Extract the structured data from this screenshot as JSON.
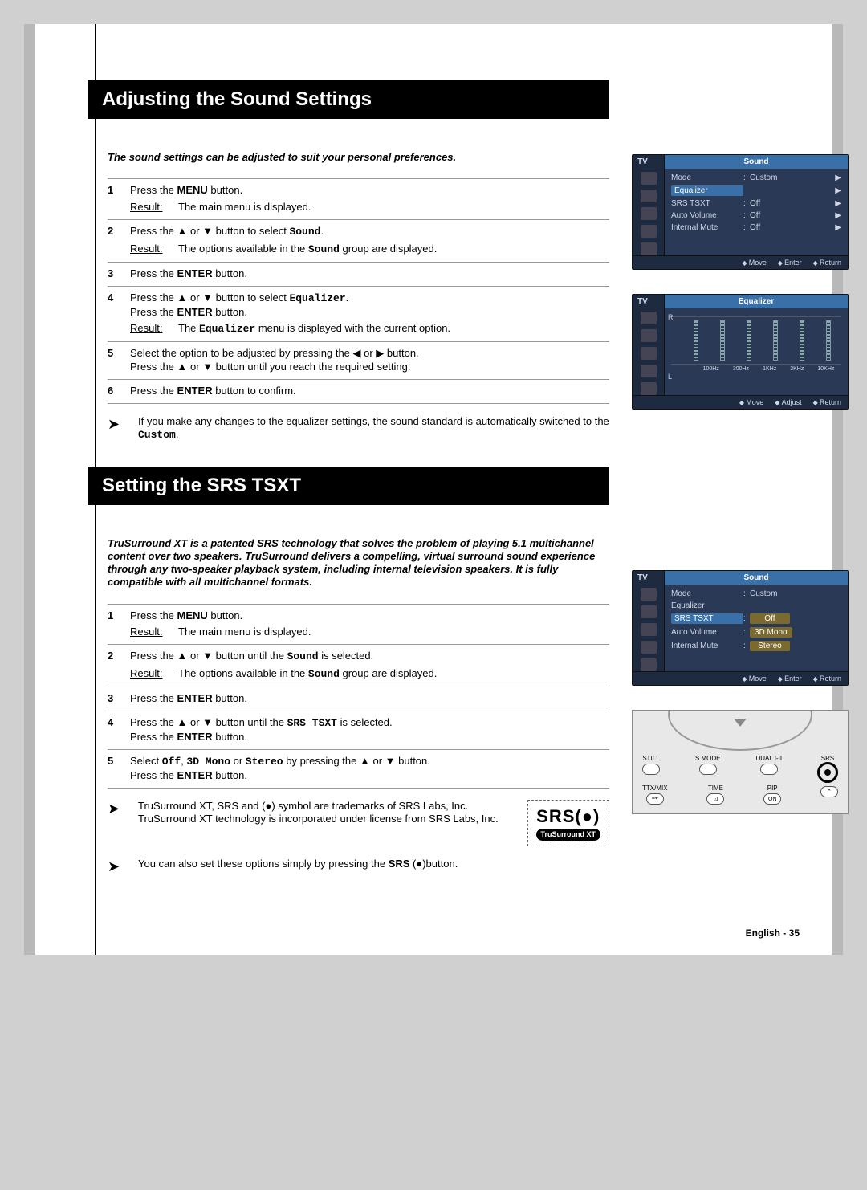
{
  "section1": {
    "title": "Adjusting the Sound Settings",
    "intro": "The sound settings can be adjusted to suit your personal preferences.",
    "steps": [
      {
        "n": "1",
        "text_a": "Press the ",
        "bold1": "MENU",
        "text_b": " button.",
        "result": "The main menu is displayed."
      },
      {
        "n": "2",
        "text_a": "Press the ▲ or ▼ button to select ",
        "mono1": "Sound",
        "text_b": ".",
        "result_a": "The options available in the ",
        "result_mono": "Sound",
        "result_b": " group are displayed."
      },
      {
        "n": "3",
        "text_a": "Press the ",
        "bold1": "ENTER",
        "text_b": " button."
      },
      {
        "n": "4",
        "text_a": "Press the ▲ or ▼ button to select ",
        "mono1": "Equalizer",
        "text_b": ".",
        "line2_a": "Press the ",
        "line2_bold": "ENTER",
        "line2_b": " button.",
        "result_a": "The ",
        "result_mono": "Equalizer",
        "result_b": " menu is displayed with the current option."
      },
      {
        "n": "5",
        "text_a": "Select the option to be adjusted by pressing the ◀ or ▶ button.",
        "line2_a": "Press the ▲ or ▼ button until you reach the required setting."
      },
      {
        "n": "6",
        "text_a": "Press the ",
        "bold1": "ENTER",
        "text_b": " button to confirm."
      }
    ],
    "note": {
      "a": "If you make any changes to the equalizer settings, the sound standard is automatically switched to the ",
      "mono": "Custom",
      "b": "."
    }
  },
  "section2": {
    "title": "Setting the SRS TSXT",
    "intro": "TruSurround XT is a patented SRS technology that solves the problem of playing 5.1 multichannel content over two speakers. TruSurround delivers a compelling, virtual surround sound experience through any two-speaker playback system, including internal television speakers. It is fully compatible with all multichannel formats.",
    "steps": [
      {
        "n": "1",
        "text_a": "Press the ",
        "bold1": "MENU",
        "text_b": " button.",
        "result": "The main menu is displayed."
      },
      {
        "n": "2",
        "text_a": "Press the ▲ or ▼ button until the ",
        "mono1": "Sound",
        "text_b": " is selected.",
        "result_a": "The options available in the ",
        "result_mono": "Sound",
        "result_b": " group are displayed."
      },
      {
        "n": "3",
        "text_a": "Press the ",
        "bold1": "ENTER",
        "text_b": " button."
      },
      {
        "n": "4",
        "text_a": "Press the ▲ or ▼ button until the ",
        "mono1": "SRS TSXT",
        "text_b": " is selected.",
        "line2_a": "Press the ",
        "line2_bold": "ENTER",
        "line2_b": " button."
      },
      {
        "n": "5",
        "text_a": "Select ",
        "mono1": "Off",
        "text_b": ", ",
        "mono2": "3D Mono",
        "text_c": " or ",
        "mono3": "Stereo",
        "text_d": "  by pressing the ▲ or ▼ button.",
        "line2_a": "Press the ",
        "line2_bold": "ENTER",
        "line2_b": " button."
      }
    ],
    "note1": "TruSurround XT, SRS and (●) symbol are trademarks of SRS Labs, Inc. TruSurround XT technology is incorporated under license from SRS Labs, Inc.",
    "note2_a": "You can also set these options simply by pressing the ",
    "note2_bold": "SRS",
    "note2_b": " (●)button.",
    "srs_logo": {
      "big": "SRS(●)",
      "pill": "TruSurround XT"
    }
  },
  "osd1": {
    "tv": "TV",
    "title": "Sound",
    "rows": [
      {
        "k": "Mode",
        "v": "Custom",
        "arrow": "▶"
      },
      {
        "k": "Equalizer",
        "v": "",
        "arrow": "▶",
        "hl": true
      },
      {
        "k": "SRS TSXT",
        "v": "Off",
        "arrow": "▶"
      },
      {
        "k": "Auto Volume",
        "v": "Off",
        "arrow": "▶"
      },
      {
        "k": "Internal Mute",
        "v": "Off",
        "arrow": "▶"
      }
    ],
    "ft": [
      "Move",
      "Enter",
      "Return"
    ]
  },
  "osd2": {
    "tv": "TV",
    "title": "Equalizer",
    "bands": [
      "100Hz",
      "300Hz",
      "1KHz",
      "3KHz",
      "10KHz"
    ],
    "rl": {
      "r": "R",
      "l": "L"
    },
    "ft": [
      "Move",
      "Adjust",
      "Return"
    ]
  },
  "osd3": {
    "tv": "TV",
    "title": "Sound",
    "rows": [
      {
        "k": "Mode",
        "v": "Custom"
      },
      {
        "k": "Equalizer",
        "v": ""
      },
      {
        "k": "SRS TSXT",
        "v": "Off",
        "khl": true,
        "vbox": true
      },
      {
        "k": "Auto Volume",
        "v": "3D Mono",
        "vbox": true
      },
      {
        "k": "Internal Mute",
        "v": "Stereo",
        "vbox": true
      }
    ],
    "ft": [
      "Move",
      "Enter",
      "Return"
    ]
  },
  "remote": {
    "row1": [
      "STILL",
      "S.MODE",
      "DUAL I-II",
      "SRS"
    ],
    "row2": [
      "TTX/MIX",
      "TIME",
      "PIP",
      ""
    ],
    "row2_icons": [
      "≡⌖",
      "⊡",
      "ON",
      "⌃"
    ]
  },
  "footer": "English - 35",
  "result_label": "Result:"
}
